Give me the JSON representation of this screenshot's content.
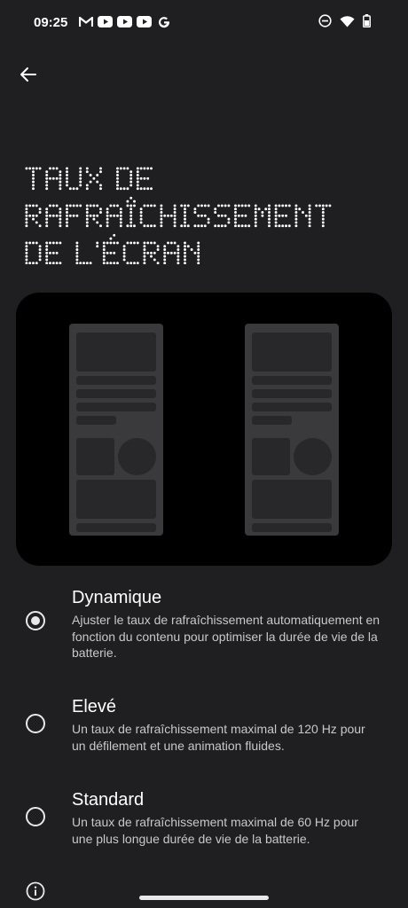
{
  "status_bar": {
    "time": "09:25",
    "left_icons": [
      "gmail-icon",
      "youtube-icon",
      "youtube-icon",
      "youtube-icon",
      "google-icon"
    ],
    "right_icons": [
      "do-not-disturb-icon",
      "wifi-icon",
      "battery-icon"
    ]
  },
  "header": {
    "title_lines": [
      "TAUX DE",
      "RAFRAÎCHISSEMENT",
      "DE L'ÉCRAN"
    ]
  },
  "options": [
    {
      "title": "Dynamique",
      "description": "Ajuster le taux de rafraîchissement automatiquement en fonction du contenu pour optimiser la durée de vie de la batterie.",
      "selected": true
    },
    {
      "title": "Elevé",
      "description": "Un taux de rafraîchissement maximal de 120 Hz pour un défilement et une animation fluides.",
      "selected": false
    },
    {
      "title": "Standard",
      "description": "Un taux de rafraîchissement maximal de 60 Hz pour une plus longue durée de vie de la batterie.",
      "selected": false
    }
  ],
  "colors": {
    "background": "#1f1f21",
    "preview_background": "#000000",
    "text_primary": "#ffffff",
    "text_secondary": "#c8c8c8"
  }
}
